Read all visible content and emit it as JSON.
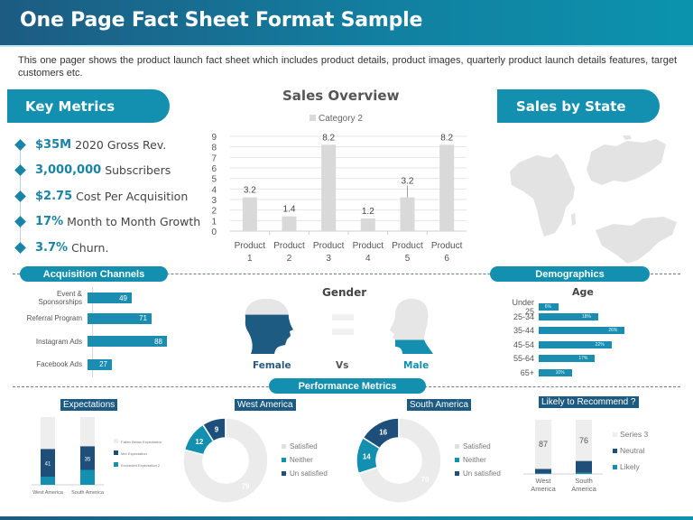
{
  "header": {
    "title": "One Page Fact Sheet Format Sample",
    "intro": "This one pager shows the product launch fact sheet which includes product details, product images, quarterly product launch details features, target customers etc."
  },
  "key_metrics": {
    "title": "Key Metrics",
    "items": [
      {
        "value": "$35M",
        "label": "2020 Gross Rev."
      },
      {
        "value": "3,000,000",
        "label": "Subscribers"
      },
      {
        "value": "$2.75",
        "label": "Cost Per Acquisition"
      },
      {
        "value": "17%",
        "label": "Month to Month Growth"
      },
      {
        "value": "3.7%",
        "label": "Churn."
      }
    ]
  },
  "sales_by_state": {
    "title": "Sales by State",
    "map_icon": "world-map-icon"
  },
  "sections": {
    "acquisition": "Acquisition  Channels",
    "demographics": "Demographics",
    "performance": "Performance Metrics"
  },
  "gender": {
    "title": "Gender",
    "female": "Female",
    "vs": "Vs",
    "male": "Male",
    "female_fill": 0.7,
    "male_fill": 0.25,
    "colors": {
      "female": "#1d5b82",
      "male": "#1390b0",
      "empty": "#e6e6e6"
    }
  },
  "chart_data": [
    {
      "id": "sales_overview",
      "type": "bar",
      "title": "Sales Overview",
      "legend": [
        "Category 2"
      ],
      "legend_position": "top-center",
      "categories": [
        "Product 1",
        "Product 2",
        "Product 3",
        "Product 4",
        "Product 5",
        "Product 6"
      ],
      "category_lines": [
        [
          "Product",
          "1"
        ],
        [
          "Product",
          "2"
        ],
        [
          "Product",
          "3"
        ],
        [
          "Product",
          "4"
        ],
        [
          "Product",
          "5"
        ],
        [
          "Product",
          "6"
        ]
      ],
      "values": [
        3.2,
        1.4,
        8.2,
        1.2,
        3.2,
        8.2
      ],
      "labels": [
        "3.2",
        "1.4",
        "8.2",
        "1.2",
        "3.2",
        "8.2"
      ],
      "ylim": [
        0,
        9
      ],
      "yticks": [
        "0",
        "1",
        "2",
        "3",
        "4",
        "5",
        "6",
        "7",
        "8",
        "9"
      ],
      "grid": true,
      "color": "#d9d9d9"
    },
    {
      "id": "acquisition_channels",
      "type": "bar",
      "orientation": "horizontal",
      "categories": [
        "Event & Sponsorships",
        "Referral Program",
        "Instagram Ads",
        "Facebook Ads"
      ],
      "category_lines": [
        [
          "Event &",
          "Sponsorships"
        ],
        [
          "Referral Program"
        ],
        [
          "Instagram Ads"
        ],
        [
          "Facebook Ads"
        ]
      ],
      "values": [
        49,
        71,
        88,
        27
      ],
      "xlim": [
        0,
        100
      ],
      "color": "#1a8db0"
    },
    {
      "id": "age",
      "type": "bar",
      "orientation": "horizontal",
      "title": "Age",
      "categories": [
        "Under 25",
        "25-34",
        "35-44",
        "45-54",
        "55-64",
        "65+"
      ],
      "values": [
        6,
        18,
        26,
        22,
        17,
        10
      ],
      "labels": [
        "6%",
        "18%",
        "26%",
        "22%",
        "17%",
        "10%"
      ],
      "xlim": [
        0,
        30
      ],
      "color": "#1a8db0"
    },
    {
      "id": "expectations",
      "type": "bar",
      "stacked": true,
      "title": "Expectations",
      "categories": [
        "West America",
        "South America"
      ],
      "series": [
        {
          "name": "Exceeded Expectation 2",
          "values": [
            12,
            22
          ],
          "color": "#1390b0"
        },
        {
          "name": "Met Expectation",
          "values": [
            41,
            35
          ],
          "color": "#1d4f7a"
        },
        {
          "name": "Fallen Below Expectation",
          "values": [
            47,
            43
          ],
          "color": "#eeeeee"
        }
      ],
      "data_labels": [
        "41",
        "35"
      ],
      "legend": [
        "Fallen Below Expectation",
        "Met Expectation",
        "Exceeded Expectation 2"
      ]
    },
    {
      "id": "west_america",
      "type": "pie",
      "donut": true,
      "title": "West America",
      "categories": [
        "Satisfied",
        "Neither",
        "Un satisfied"
      ],
      "values": [
        79,
        12,
        9
      ],
      "labels": [
        "79",
        "12",
        "9"
      ],
      "colors": [
        "#ebebeb",
        "#1390b0",
        "#1d4f7a"
      ]
    },
    {
      "id": "south_america",
      "type": "pie",
      "donut": true,
      "title": "South America",
      "categories": [
        "Satisfied",
        "Neither",
        "Un satisfied"
      ],
      "values": [
        70,
        14,
        16
      ],
      "labels": [
        "70",
        "14",
        "16"
      ],
      "colors": [
        "#ebebeb",
        "#1390b0",
        "#1d4f7a"
      ]
    },
    {
      "id": "likely_to_recommend",
      "type": "bar",
      "stacked": true,
      "title": "Likely to Recommend ?",
      "categories": [
        "West America",
        "South America"
      ],
      "category_lines": [
        [
          "West",
          "America"
        ],
        [
          "South",
          "America"
        ]
      ],
      "series": [
        {
          "name": "Likely",
          "values": [
            1,
            2
          ],
          "color": "#1390b0"
        },
        {
          "name": "Neutral",
          "values": [
            8,
            22
          ],
          "color": "#1d4f7a"
        },
        {
          "name": "Series 3",
          "values": [
            87,
            76
          ],
          "color": "#eeeeee"
        }
      ],
      "data_labels": [
        "87",
        "76"
      ],
      "legend": [
        "Series 3",
        "Neutral",
        "Likely"
      ]
    }
  ]
}
